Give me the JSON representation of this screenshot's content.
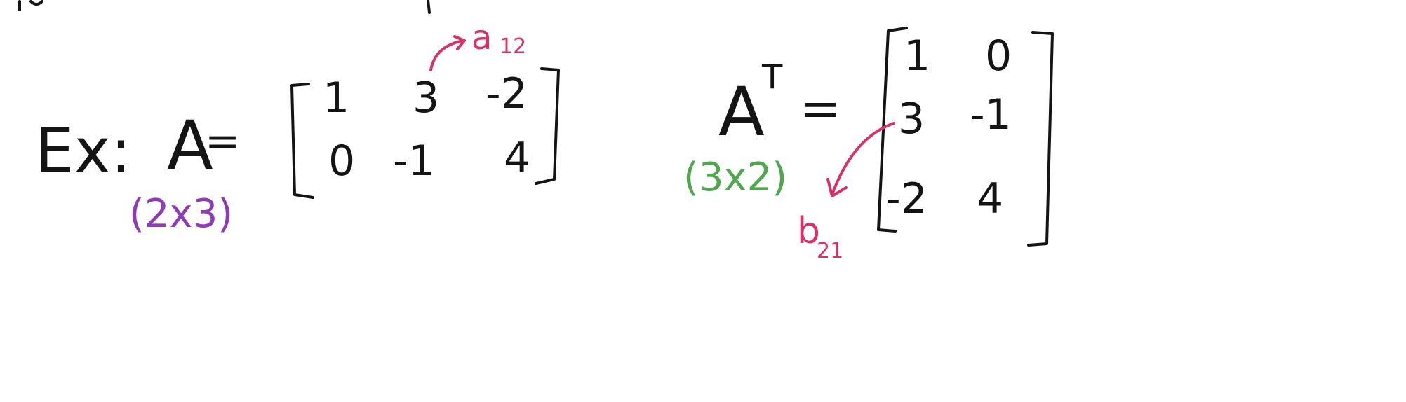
{
  "colors": {
    "ink": "#141414",
    "annotation": "#d6336c",
    "dimension_a": "#8e3bb5",
    "dimension_at": "#4fa84f"
  },
  "example": {
    "label": "Ex:",
    "matrix_name": "A",
    "equals": "=",
    "dimension": "(2x3)",
    "rows": [
      [
        "1",
        "3",
        "-2"
      ],
      [
        "0",
        "-1",
        "4"
      ]
    ],
    "annotation": {
      "letter": "a",
      "subscript": "12"
    }
  },
  "transpose": {
    "name": "A",
    "superscript": "T",
    "equals": "=",
    "dimension": "(3x2)",
    "rows": [
      [
        "1",
        "0"
      ],
      [
        "3",
        "-1"
      ],
      [
        "-2",
        "4"
      ]
    ],
    "annotation": {
      "letter": "b",
      "subscript": "21"
    }
  }
}
